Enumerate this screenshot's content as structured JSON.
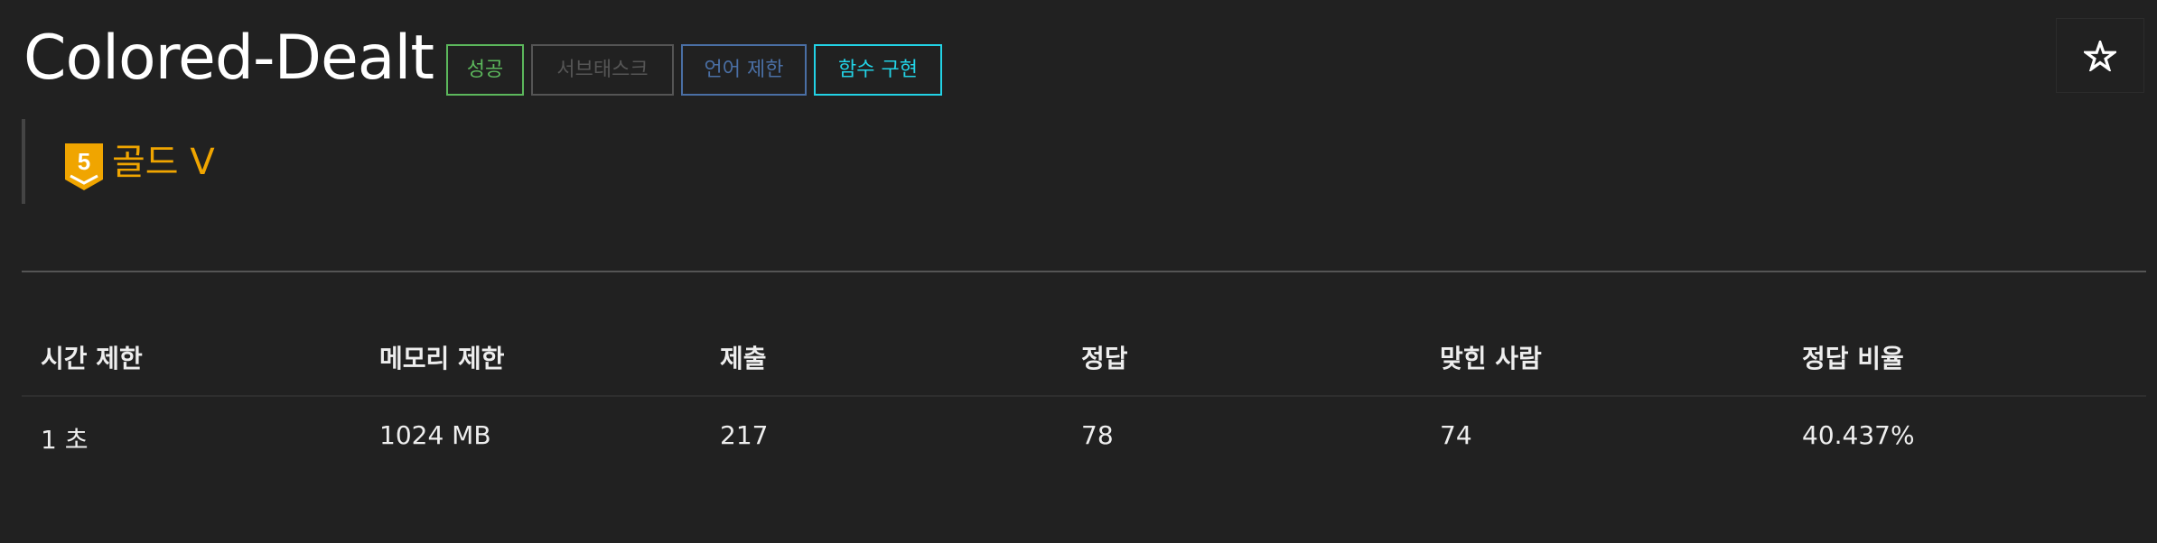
{
  "title": "Colored-Dealt",
  "badges": [
    {
      "label": "성공",
      "color": "#5cb85c"
    },
    {
      "label": "서브태스크",
      "color": "#555555"
    },
    {
      "label": "언어 제한",
      "color": "#4a6fa5"
    },
    {
      "label": "함수 구현",
      "color": "#22d3e6"
    }
  ],
  "tier": {
    "number": "5",
    "label": "골드 V",
    "color": "#f0a500"
  },
  "star_icon": "star-outline-icon",
  "table": {
    "headers": [
      "시간 제한",
      "메모리 제한",
      "제출",
      "정답",
      "맞힌 사람",
      "정답 비율"
    ],
    "values": [
      "1 초",
      "1024 MB",
      "217",
      "78",
      "74",
      "40.437%"
    ]
  }
}
